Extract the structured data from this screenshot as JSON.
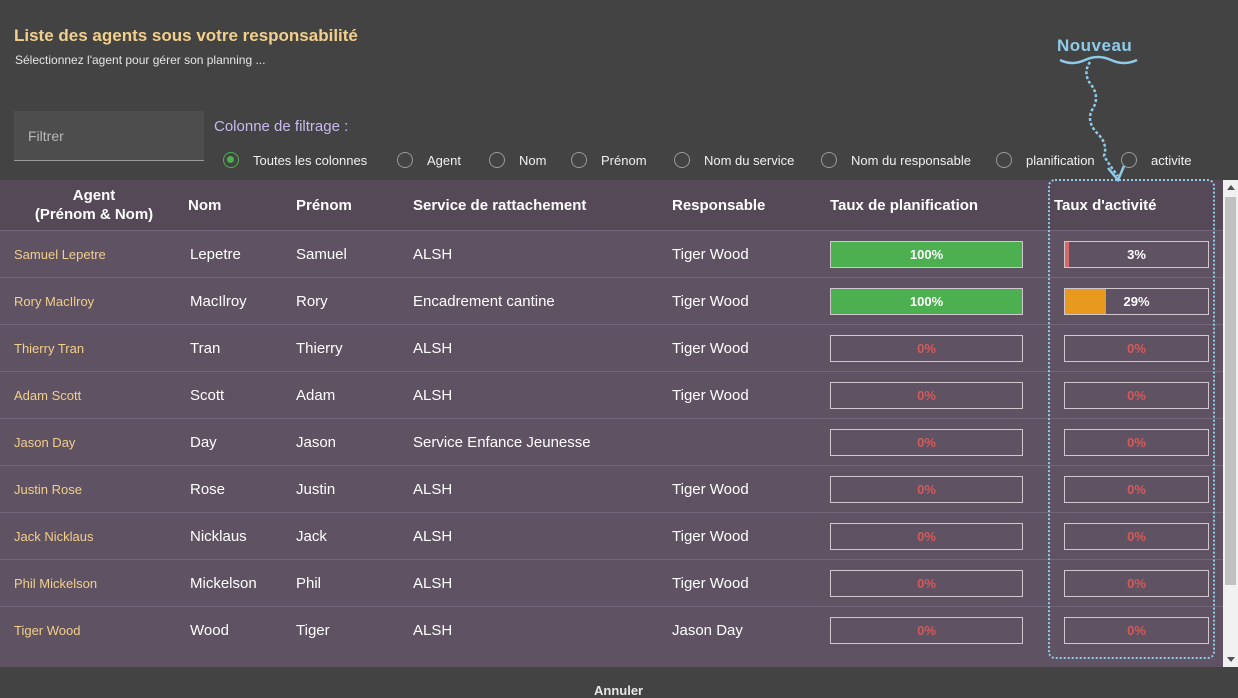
{
  "header": {
    "title": "Liste des agents sous votre responsabilité",
    "subtitle": "Sélectionnez l'agent pour gérer son planning ..."
  },
  "filter": {
    "placeholder": "Filtrer",
    "value": ""
  },
  "filter_columns": {
    "label": "Colonne de filtrage :",
    "options": [
      "Toutes les colonnes",
      "Agent",
      "Nom",
      "Prénom",
      "Nom du service",
      "Nom du responsable",
      "planification",
      "activite"
    ],
    "selected": "Toutes les colonnes"
  },
  "annotation": {
    "label": "Nouveau"
  },
  "table": {
    "headers": {
      "agent_line1": "Agent",
      "agent_line2": "(Prénom & Nom)",
      "nom": "Nom",
      "prenom": "Prénom",
      "service": "Service de rattachement",
      "responsable": "Responsable",
      "taux_plan": "Taux de planification",
      "taux_act": "Taux d'activité"
    },
    "rows": [
      {
        "agent": "Samuel Lepetre",
        "nom": "Lepetre",
        "prenom": "Samuel",
        "service": "ALSH",
        "responsable": "Tiger Wood",
        "plan": "100%",
        "plan_value": 100,
        "act": "3%",
        "act_value": 3
      },
      {
        "agent": "Rory MacIlroy",
        "nom": "MacIlroy",
        "prenom": "Rory",
        "service": "Encadrement cantine",
        "responsable": "Tiger Wood",
        "plan": "100%",
        "plan_value": 100,
        "act": "29%",
        "act_value": 29
      },
      {
        "agent": "Thierry Tran",
        "nom": "Tran",
        "prenom": "Thierry",
        "service": "ALSH",
        "responsable": "Tiger Wood",
        "plan": "0%",
        "plan_value": 0,
        "act": "0%",
        "act_value": 0
      },
      {
        "agent": "Adam Scott",
        "nom": "Scott",
        "prenom": "Adam",
        "service": "ALSH",
        "responsable": "Tiger Wood",
        "plan": "0%",
        "plan_value": 0,
        "act": "0%",
        "act_value": 0
      },
      {
        "agent": "Jason Day",
        "nom": "Day",
        "prenom": "Jason",
        "service": "Service Enfance Jeunesse",
        "responsable": "",
        "plan": "0%",
        "plan_value": 0,
        "act": "0%",
        "act_value": 0
      },
      {
        "agent": "Justin Rose",
        "nom": "Rose",
        "prenom": "Justin",
        "service": "ALSH",
        "responsable": "Tiger Wood",
        "plan": "0%",
        "plan_value": 0,
        "act": "0%",
        "act_value": 0
      },
      {
        "agent": "Jack Nicklaus",
        "nom": "Nicklaus",
        "prenom": "Jack",
        "service": "ALSH",
        "responsable": "Tiger Wood",
        "plan": "0%",
        "plan_value": 0,
        "act": "0%",
        "act_value": 0
      },
      {
        "agent": "Phil Mickelson",
        "nom": "Mickelson",
        "prenom": "Phil",
        "service": "ALSH",
        "responsable": "Tiger Wood",
        "plan": "0%",
        "plan_value": 0,
        "act": "0%",
        "act_value": 0
      },
      {
        "agent": "Tiger Wood",
        "nom": "Wood",
        "prenom": "Tiger",
        "service": "ALSH",
        "responsable": "Jason Day",
        "plan": "0%",
        "plan_value": 0,
        "act": "0%",
        "act_value": 0
      }
    ]
  },
  "footer": {
    "cancel_label": "Annuler"
  },
  "colors": {
    "title": "#f2cf8a",
    "agent_link": "#f2cf8a",
    "filter_label": "#c9b9ee",
    "radio_selected": "#4caf50",
    "plan_fill": "#4caf50",
    "act_fill_low": "#d46a6a",
    "act_fill_mid": "#e89a1e",
    "zero_text": "#d45a5a",
    "annotation": "#8ecbe8"
  }
}
